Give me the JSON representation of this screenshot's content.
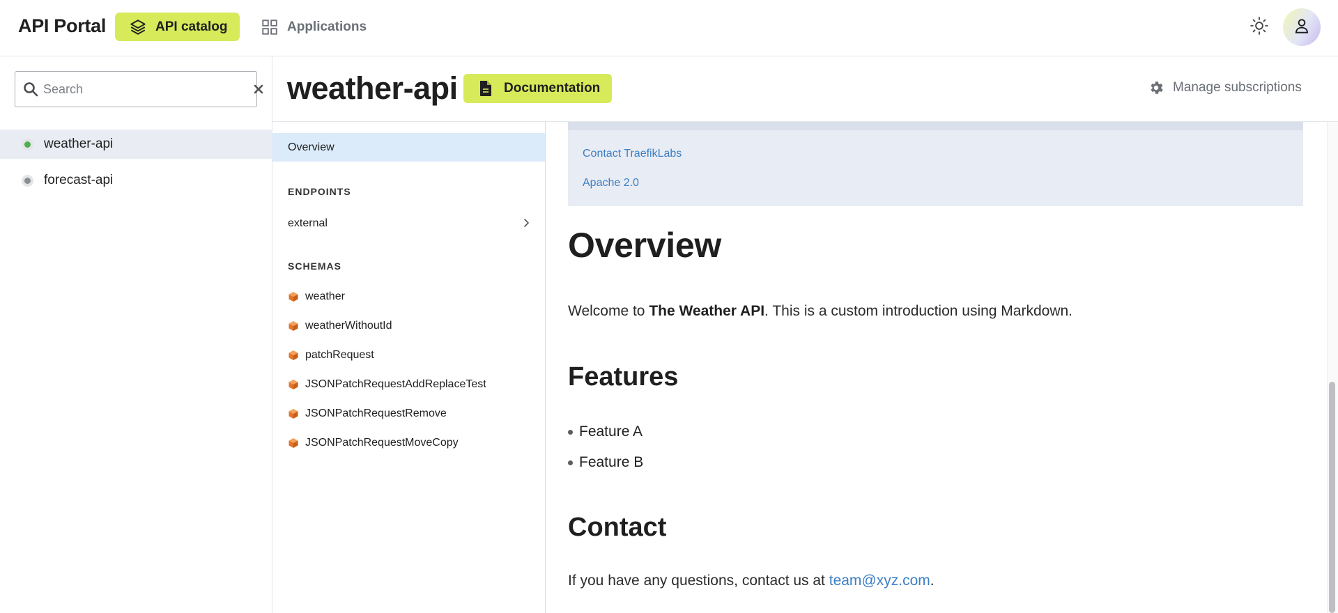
{
  "topbar": {
    "brand": "API Portal",
    "nav": {
      "api_catalog": "API catalog",
      "applications": "Applications"
    },
    "icons": {
      "api_catalog": "layers-icon",
      "applications": "grid-icon",
      "theme": "sun-icon",
      "avatar": "user-icon"
    },
    "accent_color": "#d6ea5a"
  },
  "sidebar": {
    "search": {
      "placeholder": "Search",
      "value": ""
    },
    "apis": [
      {
        "label": "weather-api",
        "status": "active",
        "status_color": "#4caf50",
        "selected": true
      },
      {
        "label": "forecast-api",
        "status": "inactive",
        "status_color": "#8a8d91",
        "selected": false
      }
    ]
  },
  "header": {
    "title": "weather-api",
    "documentation_label": "Documentation",
    "manage_label": "Manage subscriptions"
  },
  "docnav": {
    "overview_label": "Overview",
    "endpoints_heading": "ENDPOINTS",
    "endpoints": [
      "external"
    ],
    "schemas_heading": "SCHEMAS",
    "schemas": [
      "weather",
      "weatherWithoutId",
      "patchRequest",
      "JSONPatchRequestAddReplaceTest",
      "JSONPatchRequestRemove",
      "JSONPatchRequestMoveCopy"
    ]
  },
  "content": {
    "info_links": {
      "contact": "Contact TraefikLabs",
      "license": "Apache 2.0"
    },
    "overview_heading": "Overview",
    "intro_prefix": "Welcome to ",
    "intro_bold": "The Weather API",
    "intro_suffix": ". This is a custom introduction using Markdown.",
    "features_heading": "Features",
    "features": [
      "Feature A",
      "Feature B"
    ],
    "contact_heading": "Contact",
    "contact_prefix": "If you have any questions, contact us at ",
    "contact_email": "team@xyz.com",
    "contact_suffix": ".",
    "link_color": "#3b7fc4"
  }
}
